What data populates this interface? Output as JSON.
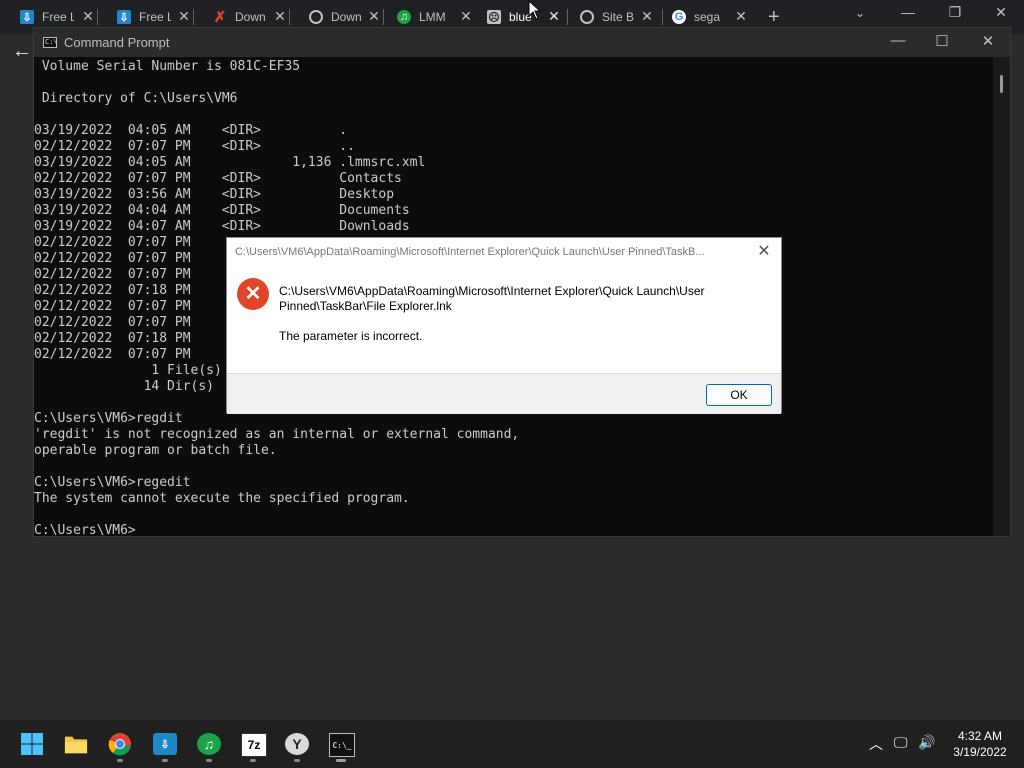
{
  "browser": {
    "tabs": [
      {
        "title": "Free L",
        "icon": "free-download-icon"
      },
      {
        "title": "Free L",
        "icon": "free-download-icon"
      },
      {
        "title": "Down",
        "icon": "red-x-icon"
      },
      {
        "title": "Down",
        "icon": "globe-icon"
      },
      {
        "title": "LMM",
        "icon": "headphones-icon"
      },
      {
        "title": "blue",
        "icon": "sad-face-icon"
      },
      {
        "title": "Site B",
        "icon": "globe-icon"
      },
      {
        "title": "sega",
        "icon": "google-icon"
      }
    ],
    "new_tab_symbol": "+",
    "close_symbol": "✕",
    "colors": {
      "tabbar": "#202124"
    }
  },
  "cmd": {
    "title": "Command Prompt",
    "lines": [
      " Volume Serial Number is 081C-EF35",
      "",
      " Directory of C:\\Users\\VM6",
      "",
      "03/19/2022  04:05 AM    <DIR>          .",
      "02/12/2022  07:07 PM    <DIR>          ..",
      "03/19/2022  04:05 AM             1,136 .lmmsrc.xml",
      "02/12/2022  07:07 PM    <DIR>          Contacts",
      "03/19/2022  03:56 AM    <DIR>          Desktop",
      "03/19/2022  04:04 AM    <DIR>          Documents",
      "03/19/2022  04:07 AM    <DIR>          Downloads",
      "02/12/2022  07:07 PM",
      "02/12/2022  07:07 PM",
      "02/12/2022  07:07 PM",
      "02/12/2022  07:18 PM",
      "02/12/2022  07:07 PM",
      "02/12/2022  07:07 PM",
      "02/12/2022  07:18 PM",
      "02/12/2022  07:07 PM",
      "               1 File(s)",
      "              14 Dir(s)",
      "",
      "C:\\Users\\VM6>regdit",
      "'regdit' is not recognized as an internal or external command,",
      "operable program or batch file.",
      "",
      "C:\\Users\\VM6>regedit",
      "The system cannot execute the specified program.",
      "",
      "C:\\Users\\VM6>"
    ],
    "colors": {
      "background": "#0c0c0c",
      "text": "#cccccc"
    }
  },
  "dialog": {
    "title": "C:\\Users\\VM6\\AppData\\Roaming\\Microsoft\\Internet Explorer\\Quick Launch\\User Pinned\\TaskB...",
    "path": "C:\\Users\\VM6\\AppData\\Roaming\\Microsoft\\Internet Explorer\\Quick Launch\\User Pinned\\TaskBar\\File Explorer.lnk",
    "message": "The parameter is incorrect.",
    "ok_label": "OK",
    "icon": "error-icon",
    "colors": {
      "error": "#e0452b",
      "ok_border": "#0067c0"
    }
  },
  "taskbar": {
    "apps": [
      {
        "name": "start",
        "icon": "windows-logo-icon",
        "label": ""
      },
      {
        "name": "file-explorer",
        "icon": "folder-icon",
        "label": ""
      },
      {
        "name": "chrome",
        "icon": "chrome-icon",
        "label": ""
      },
      {
        "name": "free-download",
        "icon": "free-download-icon",
        "label": ""
      },
      {
        "name": "lmms",
        "icon": "headphones-icon",
        "label": ""
      },
      {
        "name": "7zip",
        "icon": "7zip-icon",
        "label": "7z"
      },
      {
        "name": "yandex",
        "icon": "yandex-icon",
        "label": "Y"
      },
      {
        "name": "cmd",
        "icon": "terminal-icon",
        "label": ""
      }
    ],
    "tray": {
      "time": "4:32 AM",
      "date": "3/19/2022"
    }
  }
}
